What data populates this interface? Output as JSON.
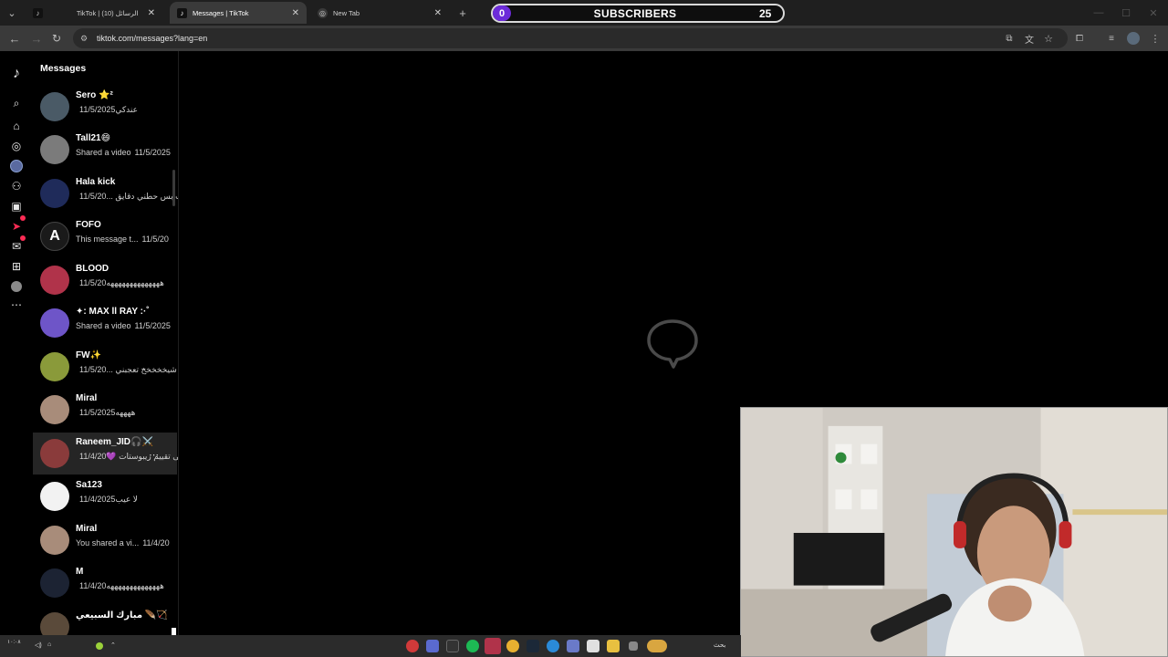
{
  "browser": {
    "tabs": [
      {
        "title": "TikTok | الرسائل (10)",
        "active": false
      },
      {
        "title": "Messages | TikTok",
        "active": true
      },
      {
        "title": "New Tab",
        "active": false
      }
    ],
    "url": "tiktok.com/messages?lang=en"
  },
  "overlay": {
    "subscribers_current": "0",
    "subscribers_label": "SUBSCRIBERS",
    "subscribers_goal": "25"
  },
  "messages": {
    "title": "Messages",
    "conversations": [
      {
        "name": "Sero ⭐²",
        "preview": "عندكي",
        "date": "11/5/2025",
        "avatar_color": "#4a5a66"
      },
      {
        "name": "Tall21😄",
        "preview": "Shared a video",
        "date": "11/5/2025",
        "avatar_color": "#7b7b7b"
      },
      {
        "name": "Hala kick",
        "preview": "القوت بس حطني دقايق ...",
        "date": "11/5/20",
        "avatar_color": "#1f2b5a"
      },
      {
        "name": "FOFO",
        "preview": "This message t...",
        "date": "11/5/20",
        "avatar_color": "#1a1a1a"
      },
      {
        "name": "BLOOD",
        "preview": "ههههههههههههههه",
        "date": "11/5/20",
        "avatar_color": "#b0334a"
      },
      {
        "name": "✦: MAX ll RAY :·˚",
        "preview": "Shared a video",
        "date": "11/5/2025",
        "avatar_color": "#6e55c8"
      },
      {
        "name": "FW✨",
        "preview": "يا شيخخخخخ تعجبني ...",
        "date": "11/5/20",
        "avatar_color": "#8a9a3a"
      },
      {
        "name": "Miral",
        "preview": "ههههه",
        "date": "11/5/2025",
        "avatar_color": "#a88c7a"
      },
      {
        "name": "Raneem_JID🎧⚔️",
        "preview": "ابغى تقييم ريبوستات 💜",
        "date": "11/4/20",
        "avatar_color": "#8a3b3b",
        "hover": true
      },
      {
        "name": "Sa123",
        "preview": "لا عيب",
        "date": "11/4/2025",
        "avatar_color": "#f2f2f2"
      },
      {
        "name": "Miral",
        "preview": "You shared a vi...",
        "date": "11/4/20",
        "avatar_color": "#a88c7a"
      },
      {
        "name": "M",
        "preview": "ههههههههههههههه",
        "date": "11/4/20",
        "avatar_color": "#1c2333"
      },
      {
        "name": "مبارك السبيعي 🪶🏹",
        "preview": "",
        "date": "",
        "avatar_color": "#5a4a3a"
      }
    ]
  },
  "rail_icons": [
    "tiktok-logo-icon",
    "search-icon",
    "home-icon",
    "explore-icon",
    "live-avatar-icon",
    "following-icon",
    "live-icon",
    "activity-icon",
    "messages-icon",
    "upload-icon",
    "profile-icon",
    "more-icon"
  ],
  "taskbar": {
    "clock": "١٠:٠٨",
    "search_label": "بحث"
  },
  "colors": {
    "accent": "#fe2c55",
    "subscriber_badge": "#6c2bd9"
  }
}
